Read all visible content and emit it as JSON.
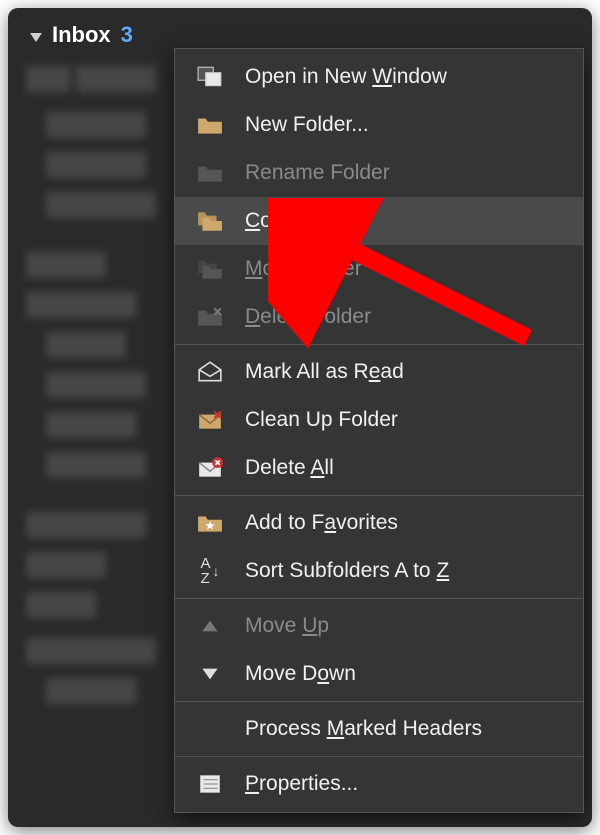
{
  "sidebar": {
    "folder_label": "Inbox",
    "unread_count": "3"
  },
  "menu": {
    "open_new_window": "Open in New Window",
    "new_folder": "New Folder...",
    "rename_folder": "Rename Folder",
    "copy_folder": "Copy Folder",
    "move_folder": "Move Folder",
    "delete_folder": "Delete Folder",
    "mark_all_read": "Mark All as Read",
    "clean_up": "Clean Up Folder",
    "delete_all": "Delete All",
    "add_favorites": "Add to Favorites",
    "sort_subfolders": "Sort Subfolders A to Z",
    "move_up": "Move Up",
    "move_down": "Move Down",
    "process_marked": "Process Marked Headers",
    "properties": "Properties..."
  },
  "state": {
    "hovered_item": "copy_folder",
    "disabled_items": [
      "rename_folder",
      "move_folder",
      "delete_folder",
      "move_up"
    ]
  },
  "annotation": {
    "arrow_color": "#ff0000"
  }
}
